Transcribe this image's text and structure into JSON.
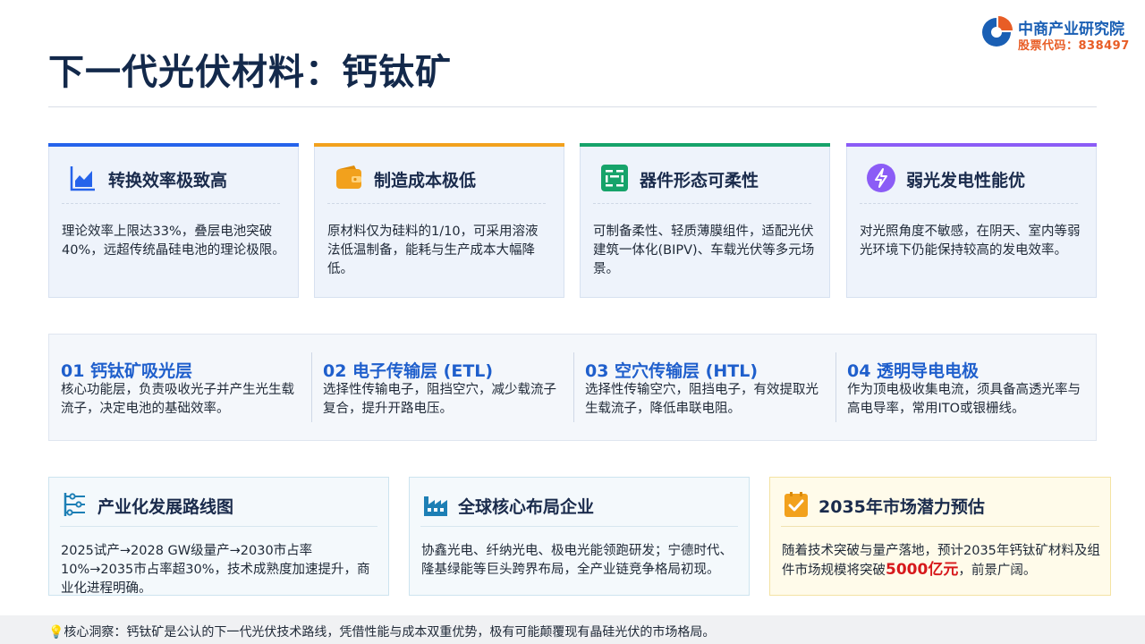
{
  "header": {
    "title": "下一代光伏材料：钙钛矿",
    "logo_name": "中商产业研究院",
    "logo_code": "股票代码：838497"
  },
  "colors": {
    "title": "#13294b",
    "blue_bar": "#2563eb",
    "orange_bar": "#f2a11d",
    "green_bar": "#16a36a",
    "purple_bar": "#8b5cf6",
    "accent_blue": "#1f5fcc",
    "highlight_red": "#d7191c"
  },
  "features": [
    {
      "icon": "chart-icon",
      "title": "转换效率极致高",
      "body": "理论效率上限达33%，叠层电池突破40%，远超传统晶硅电池的理论极限。"
    },
    {
      "icon": "wallet-icon",
      "title": "制造成本极低",
      "body": "原材料仅为硅料的1/10，可采用溶液法低温制备，能耗与生产成本大幅降低。"
    },
    {
      "icon": "panel-icon",
      "title": "器件形态可柔性",
      "body": "可制备柔性、轻质薄膜组件，适配光伏建筑一体化(BIPV)、车载光伏等多元场景。"
    },
    {
      "icon": "lightning-icon",
      "title": "弱光发电性能优",
      "body": "对光照角度不敏感，在阴天、室内等弱光环境下仍能保持较高的发电效率。"
    }
  ],
  "layers": [
    {
      "title": "01 钙钛矿吸光层",
      "body": "核心功能层，负责吸收光子并产生光生载流子，决定电池的基础效率。"
    },
    {
      "title": "02 电子传输层 (ETL)",
      "body": "选择性传输电子，阻挡空穴，减少载流子复合，提升开路电压。"
    },
    {
      "title": "03 空穴传输层 (HTL)",
      "body": "选择性传输空穴，阻挡电子，有效提取光生载流子，降低串联电阻。"
    },
    {
      "title": "04 透明导电电极",
      "body": "作为顶电极收集电流，须具备高透光率与高电导率，常用ITO或银栅线。"
    }
  ],
  "cards": {
    "roadmap": {
      "icon": "roadmap-icon",
      "title": "产业化发展路线图",
      "body": "2025试产→2028 GW级量产→2030市占率10%→2035市占率超30%，技术成熟度加速提升，商业化进程明确。"
    },
    "companies": {
      "icon": "factory-icon",
      "title": "全球核心布局企业",
      "body": "协鑫光电、纤纳光电、极电光能领跑研发；宁德时代、隆基绿能等巨头跨界布局，全产业链竞争格局初现。"
    },
    "forecast": {
      "icon": "checkbox-icon",
      "title": "2035年市场潜力预估",
      "body_pre": "随着技术突破与量产落地，预计2035年钙钛矿材料及组件市场规模将突破",
      "highlight": "5000亿元",
      "body_post": "，前景广阔。"
    }
  },
  "footer": {
    "icon": "lightbulb-icon",
    "text": "💡核心洞察：钙钛矿是公认的下一代光伏技术路线，凭借性能与成本双重优势，极有可能颠覆现有晶硅光伏的市场格局。"
  }
}
